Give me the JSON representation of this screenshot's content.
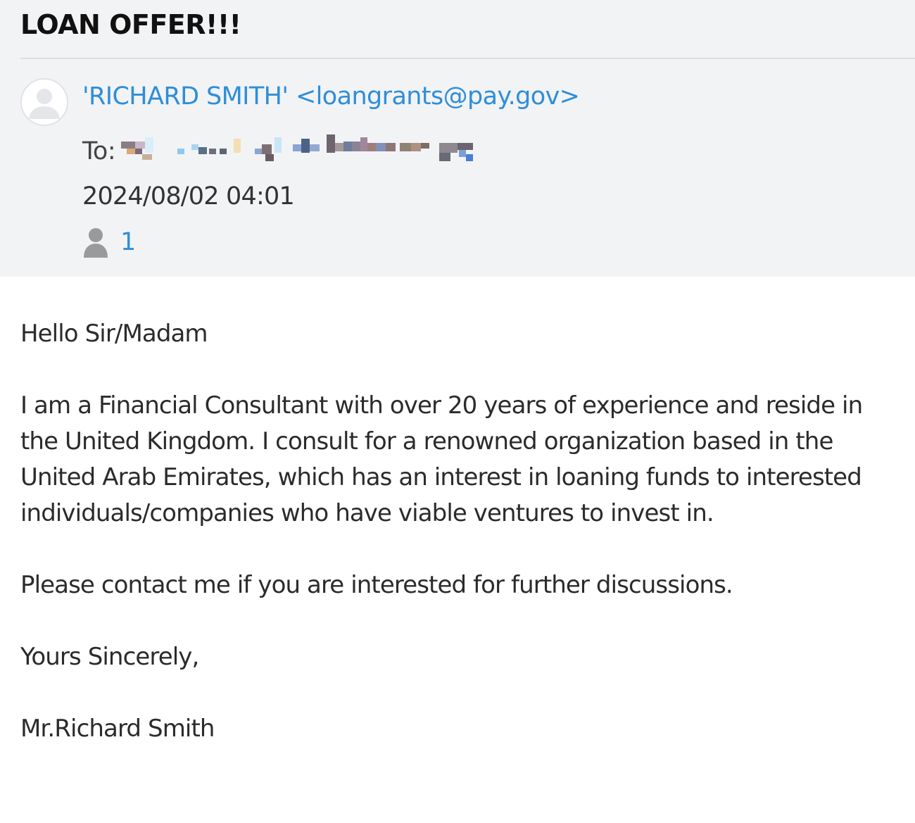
{
  "email": {
    "subject": "LOAN OFFER!!!",
    "sender": "'RICHARD SMITH' <loangrants@pay.gov>",
    "to_label": "To:",
    "date": "2024/08/02 04:01",
    "recipient_count": "1",
    "body": {
      "greeting": "Hello Sir/Madam",
      "paragraph1": "I am a Financial Consultant with over 20 years of experience and reside in the United Kingdom. I consult for a renowned organization based in the United Arab Emirates, which has an interest in loaning funds to interested individuals/companies who have viable ventures to invest in.",
      "paragraph2": "Please contact me if you are interested for further discussions.",
      "closing": "Yours Sincerely,",
      "signature": "Mr.Richard Smith"
    }
  },
  "icons": {
    "avatar": "user-avatar-icon",
    "recipients": "person-icon"
  },
  "colors": {
    "link": "#2f8ed8",
    "header_background": "#f2f3f5",
    "text": "#2b2b2b"
  }
}
